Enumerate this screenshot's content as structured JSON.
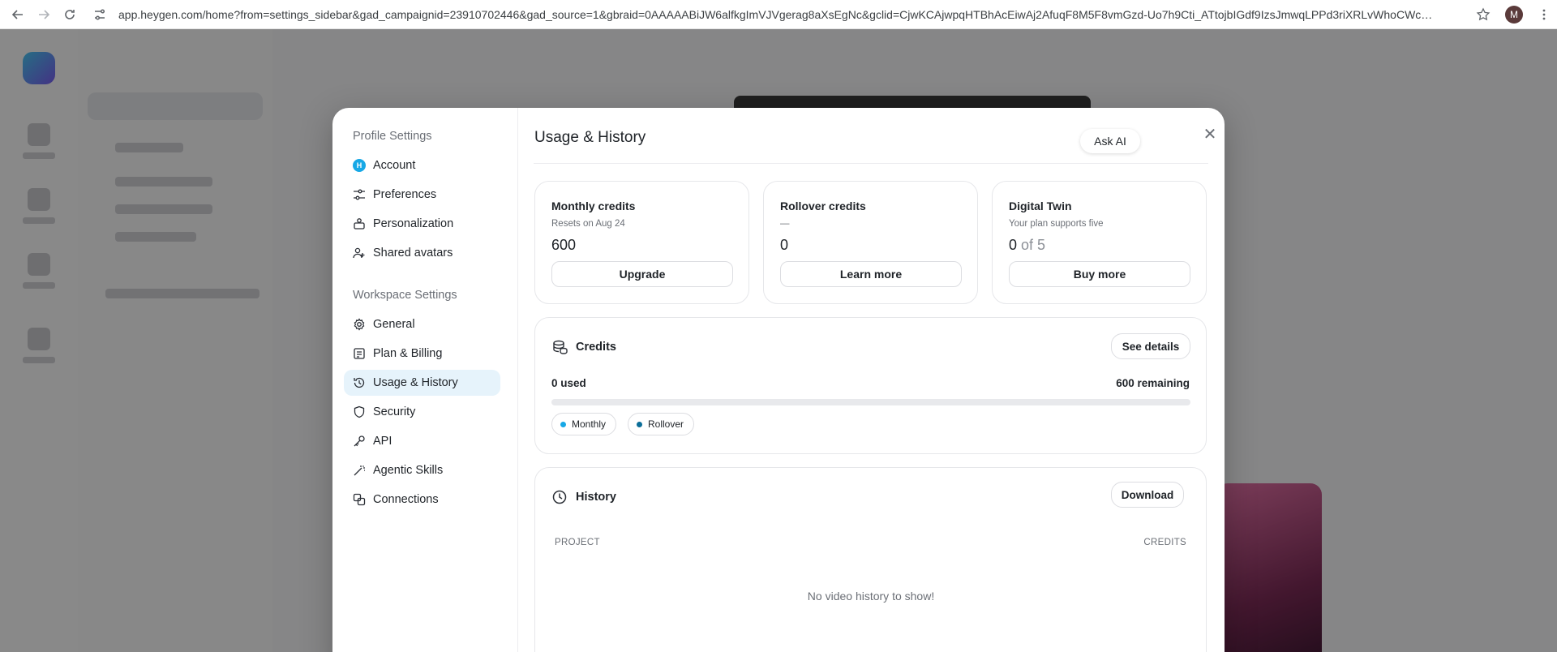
{
  "browser": {
    "url": "app.heygen.com/home?from=settings_sidebar&gad_campaignid=23910702446&gad_source=1&gbraid=0AAAAABiJW6alfkgImVJVgerag8aXsEgNc&gclid=CjwKCAjwpqHTBhAcEiwAj2AfuqF8M5F8vmGzd-Uo7h9Cti_ATtojbIGdf9IzsJmwqLPPd3riXRLvWhoCWcQQAvD_...",
    "profile_initial": "M"
  },
  "modal": {
    "sidebar": {
      "profile_title": "Profile Settings",
      "profile_items": [
        {
          "label": "Account",
          "icon": "account-avatar-icon"
        },
        {
          "label": "Preferences",
          "icon": "sliders-icon"
        },
        {
          "label": "Personalization",
          "icon": "personalization-icon"
        },
        {
          "label": "Shared avatars",
          "icon": "shared-users-icon"
        }
      ],
      "account_initial": "H",
      "workspace_title": "Workspace Settings",
      "workspace_items": [
        {
          "label": "General",
          "icon": "gear-icon"
        },
        {
          "label": "Plan & Billing",
          "icon": "receipt-icon"
        },
        {
          "label": "Usage & History",
          "icon": "history-icon",
          "active": true
        },
        {
          "label": "Security",
          "icon": "shield-icon"
        },
        {
          "label": "API",
          "icon": "key-icon"
        },
        {
          "label": "Agentic Skills",
          "icon": "wand-icon"
        },
        {
          "label": "Connections",
          "icon": "link-icon"
        }
      ]
    },
    "title": "Usage & History",
    "ask_ai": "Ask AI",
    "cards": {
      "monthly": {
        "title": "Monthly credits",
        "sub": "Resets on Aug 24",
        "value": "600",
        "button": "Upgrade"
      },
      "rollover": {
        "title": "Rollover credits",
        "sub": "—",
        "value": "0",
        "button": "Learn more"
      },
      "twin": {
        "title": "Digital Twin",
        "sub": "Your plan supports five",
        "value_main": "0",
        "value_rest": "of 5",
        "button": "Buy more"
      }
    },
    "credits": {
      "title": "Credits",
      "see_details": "See details",
      "used": "0 used",
      "remaining": "600 remaining",
      "used_fraction": 0,
      "legend": [
        {
          "label": "Monthly",
          "color": "#17a8e6"
        },
        {
          "label": "Rollover",
          "color": "#0b6e99"
        }
      ]
    },
    "history": {
      "title": "History",
      "download": "Download",
      "col_project": "PROJECT",
      "col_credits": "CREDITS",
      "empty": "No video history to show!"
    }
  },
  "colors": {
    "accent": "#17a8e6",
    "active_bg": "#e6f3fb"
  }
}
